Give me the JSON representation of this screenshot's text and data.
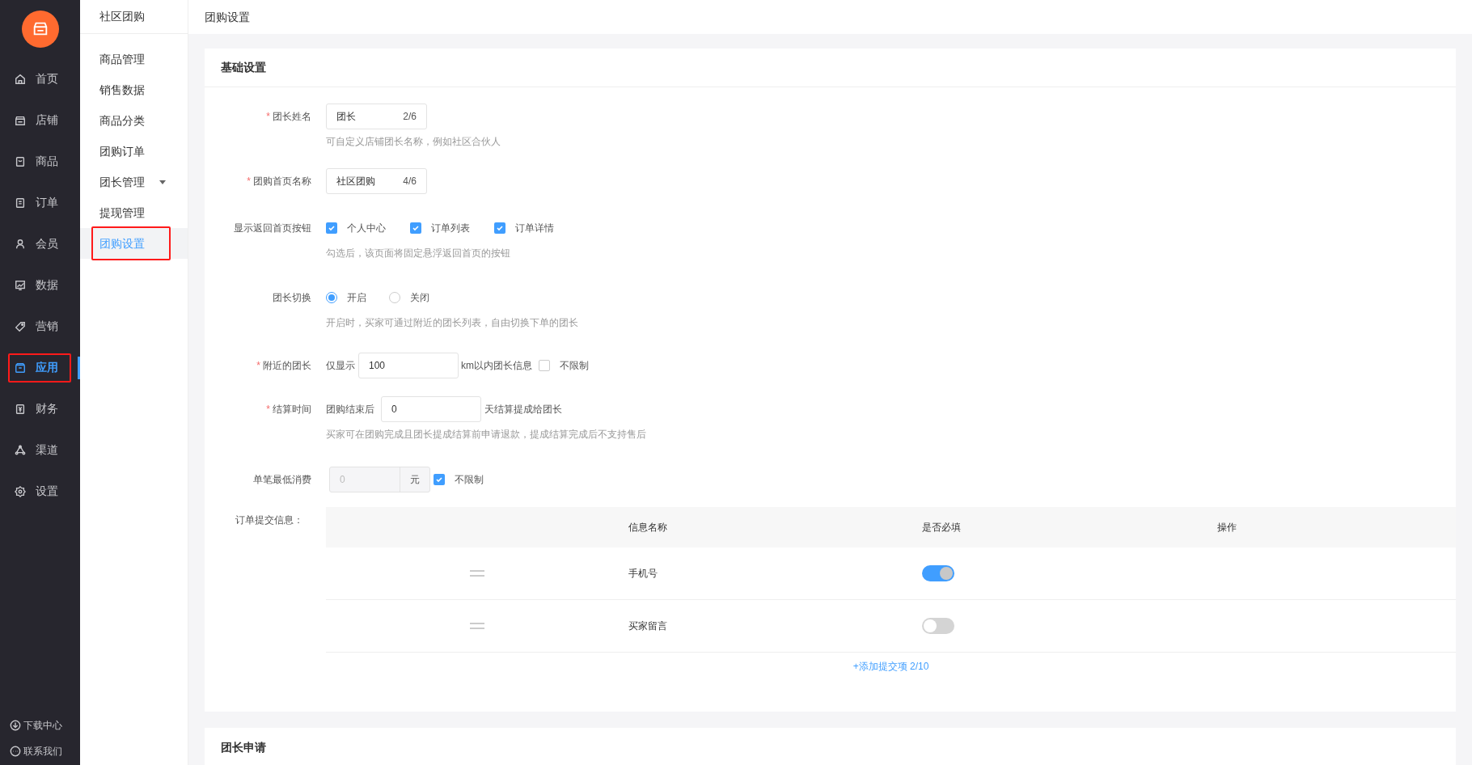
{
  "sidebar": {
    "nav": [
      {
        "label": "首页",
        "selected": false,
        "highlighted": false
      },
      {
        "label": "店铺",
        "selected": false,
        "highlighted": false
      },
      {
        "label": "商品",
        "selected": false,
        "highlighted": false
      },
      {
        "label": "订单",
        "selected": false,
        "highlighted": false
      },
      {
        "label": "会员",
        "selected": false,
        "highlighted": false
      },
      {
        "label": "数据",
        "selected": false,
        "highlighted": false
      },
      {
        "label": "营销",
        "selected": false,
        "highlighted": false
      },
      {
        "label": "应用",
        "selected": true,
        "highlighted": true
      },
      {
        "label": "财务",
        "selected": false,
        "highlighted": false
      },
      {
        "label": "渠道",
        "selected": false,
        "highlighted": false
      },
      {
        "label": "设置",
        "selected": false,
        "highlighted": false
      }
    ],
    "footer": [
      {
        "label": "下载中心"
      },
      {
        "label": "联系我们"
      }
    ]
  },
  "submenu": {
    "title": "社区团购",
    "items": [
      {
        "label": "商品管理",
        "selected": false,
        "highlighted": false,
        "expandable": false
      },
      {
        "label": "销售数据",
        "selected": false,
        "highlighted": false,
        "expandable": false
      },
      {
        "label": "商品分类",
        "selected": false,
        "highlighted": false,
        "expandable": false
      },
      {
        "label": "团购订单",
        "selected": false,
        "highlighted": false,
        "expandable": false
      },
      {
        "label": "团长管理",
        "selected": false,
        "highlighted": false,
        "expandable": true
      },
      {
        "label": "提现管理",
        "selected": false,
        "highlighted": false,
        "expandable": false
      },
      {
        "label": "团购设置",
        "selected": true,
        "highlighted": true,
        "expandable": false
      }
    ]
  },
  "page_title": "团购设置",
  "basic": {
    "title": "基础设置",
    "required_mark": "*",
    "fields": [
      {
        "kind": "counted",
        "label": "团长姓名",
        "required": true,
        "value": "团长",
        "count": "2/6",
        "hint": "可自定义店铺团长名称，例如社区合伙人"
      },
      {
        "kind": "counted",
        "label": "团购首页名称",
        "required": true,
        "value": "社区团购",
        "count": "4/6"
      },
      {
        "kind": "checks",
        "label": "显示返回首页按钮",
        "required": false,
        "options": [
          {
            "label": "个人中心",
            "checked": true
          },
          {
            "label": "订单列表",
            "checked": true
          },
          {
            "label": "订单详情",
            "checked": true
          }
        ],
        "hint": "勾选后，该页面将固定悬浮返回首页的按钮"
      },
      {
        "kind": "radios",
        "label": "团长切换",
        "required": false,
        "options": [
          {
            "label": "开启",
            "selected": true
          },
          {
            "label": "关闭",
            "selected": false
          }
        ],
        "hint": "开启时，买家可通过附近的团长列表，自由切换下单的团长"
      },
      {
        "kind": "distance",
        "label": "附近的团长",
        "required": true,
        "prefix": "仅显示",
        "value": "100",
        "suffix": "km以内团长信息",
        "unlimited": {
          "label": "不限制",
          "checked": false
        }
      },
      {
        "kind": "settle",
        "label": "结算时间",
        "required": true,
        "prefix": "团购结束后",
        "value": "0",
        "suffix": "天结算提成给团长",
        "hint": "买家可在团购完成且团长提成结算前申请退款，提成结算完成后不支持售后"
      },
      {
        "kind": "minspend",
        "label": "单笔最低消费",
        "required": false,
        "value": "0",
        "disabled": true,
        "unit": "元",
        "unlimited": {
          "label": "不限制",
          "checked": true
        }
      }
    ],
    "order_info": {
      "label": "订单提交信息：",
      "columns": [
        "信息名称",
        "是否必填",
        "操作"
      ],
      "rows": [
        {
          "name": "手机号",
          "on": true
        },
        {
          "name": "买家留言",
          "on": false
        }
      ],
      "add_link": "+添加提交项 2/10"
    }
  },
  "applicant": {
    "title": "团长申请"
  }
}
